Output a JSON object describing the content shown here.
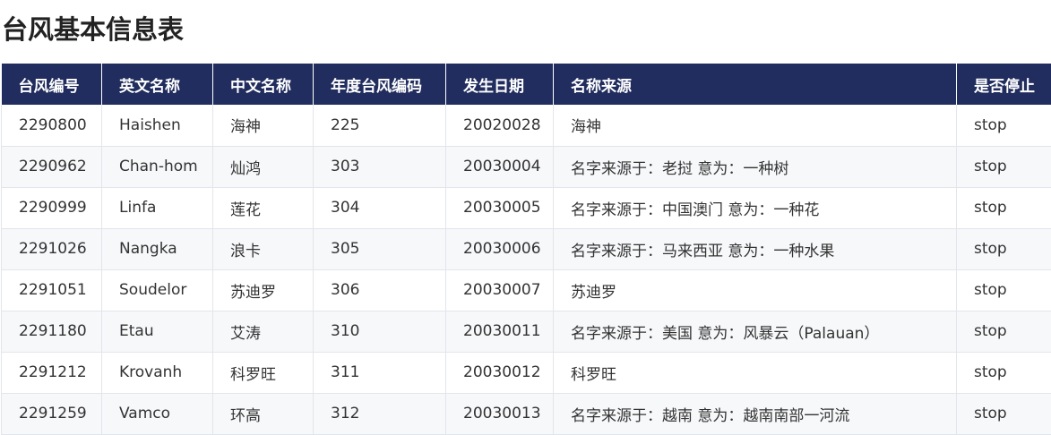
{
  "page": {
    "title": "台风基本信息表"
  },
  "table": {
    "headers": [
      "台风编号",
      "英文名称",
      "中文名称",
      "年度台风编码",
      "发生日期",
      "名称来源",
      "是否停止"
    ],
    "rows": [
      [
        "2290800",
        "Haishen",
        "海神",
        "225",
        "20020028",
        "海神",
        "stop"
      ],
      [
        "2290962",
        "Chan-hom",
        "灿鸿",
        "303",
        "20030004",
        "名字来源于：老挝 意为：一种树",
        "stop"
      ],
      [
        "2290999",
        "Linfa",
        "莲花",
        "304",
        "20030005",
        "名字来源于：中国澳门 意为：一种花",
        "stop"
      ],
      [
        "2291026",
        "Nangka",
        "浪卡",
        "305",
        "20030006",
        "名字来源于：马来西亚 意为：一种水果",
        "stop"
      ],
      [
        "2291051",
        "Soudelor",
        "苏迪罗",
        "306",
        "20030007",
        "苏迪罗",
        "stop"
      ],
      [
        "2291180",
        "Etau",
        "艾涛",
        "310",
        "20030011",
        "名字来源于：美国 意为：风暴云（Palauan）",
        "stop"
      ],
      [
        "2291212",
        "Krovanh",
        "科罗旺",
        "311",
        "20030012",
        "科罗旺",
        "stop"
      ],
      [
        "2291259",
        "Vamco",
        "环高",
        "312",
        "20030013",
        "名字来源于：越南 意为：越南南部一河流",
        "stop"
      ]
    ]
  }
}
